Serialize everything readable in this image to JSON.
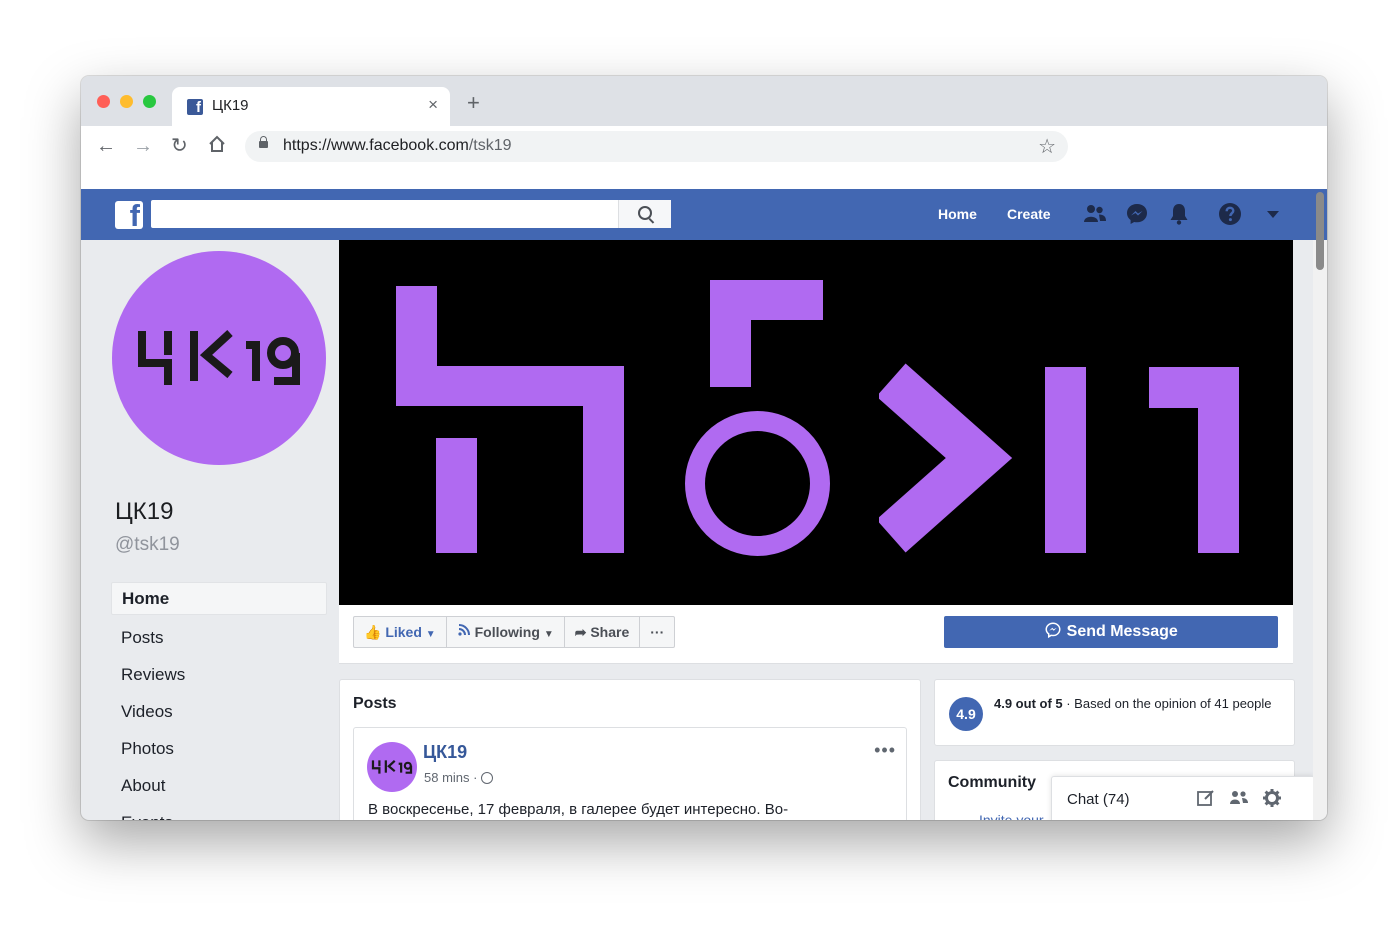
{
  "browser": {
    "tab_title": "ЦК19",
    "tab_close": "×",
    "new_tab": "+",
    "url_host": "https://www.facebook.com",
    "url_path": "/tsk19",
    "traffic_lights": [
      "#ff5f57",
      "#febc2e",
      "#28c840"
    ]
  },
  "fb_header": {
    "search_placeholder": "",
    "nav": [
      "Home",
      "Create"
    ],
    "brand_color": "#4267b2",
    "icons": [
      "friends-icon",
      "messenger-icon",
      "notifications-icon",
      "help-icon",
      "menu-dropdown-icon"
    ]
  },
  "page": {
    "logo_text": "ЦК19",
    "name": "ЦК19",
    "handle": "@tsk19",
    "accent": "#b06af1"
  },
  "sidebar": {
    "items": [
      {
        "label": "Home"
      },
      {
        "label": "Posts"
      },
      {
        "label": "Reviews"
      },
      {
        "label": "Videos"
      },
      {
        "label": "Photos"
      },
      {
        "label": "About"
      },
      {
        "label": "Events"
      }
    ]
  },
  "actions": {
    "liked": "Liked",
    "following": "Following",
    "share": "Share",
    "more": "···",
    "send_message": "Send Message"
  },
  "posts": {
    "title": "Posts",
    "author": "ЦК19",
    "time": "58 mins ·",
    "more": "•••",
    "text": "В воскресенье, 17 февраля, в галерее будет интересно. Во-"
  },
  "rating": {
    "badge": "4.9",
    "score": "4.9 out of 5",
    "text": " · Based on the opinion of 41 people"
  },
  "community": {
    "title": "Community",
    "invite": "Invite your"
  },
  "chat": {
    "label": "Chat (74)"
  }
}
